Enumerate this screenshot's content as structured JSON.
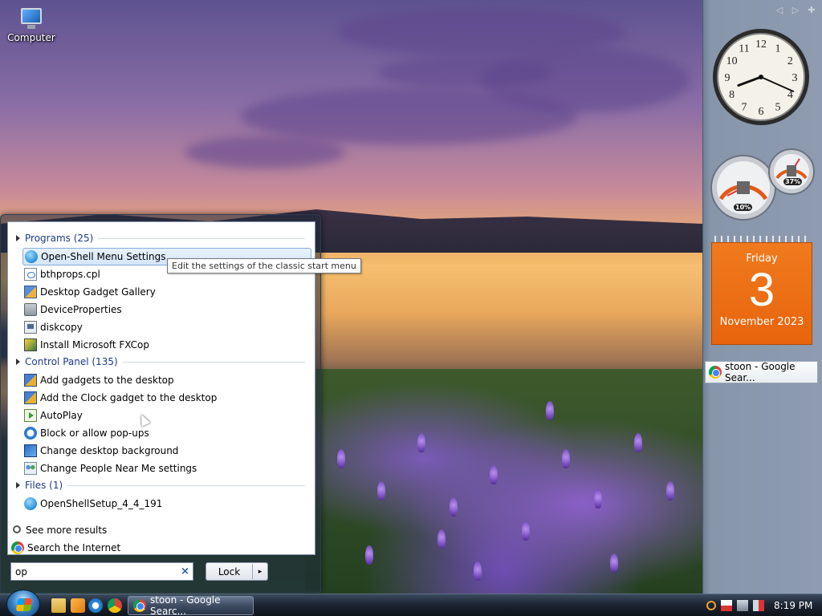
{
  "desktop": {
    "icons": [
      {
        "label": "Computer",
        "icon": "computer-icon"
      }
    ]
  },
  "sidebar": {
    "clock": {
      "hour": 8,
      "minute": 19,
      "numerals": [
        "12",
        "1",
        "2",
        "3",
        "4",
        "5",
        "6",
        "7",
        "8",
        "9",
        "10",
        "11"
      ]
    },
    "cpu_meter": {
      "cpu_percent": "10%",
      "memory_percent": "37%"
    },
    "calendar": {
      "weekday": "Friday",
      "day": "3",
      "month_year": "November 2023"
    },
    "chip": {
      "label": "stoon - Google Sear...",
      "icon": "chrome-icon"
    }
  },
  "start_menu": {
    "sections": [
      {
        "header": "Programs (25)",
        "items": [
          {
            "label": "Open-Shell Menu Settings",
            "icon": "globe-icon",
            "selected": true
          },
          {
            "label": "bthprops.cpl",
            "icon": "doc-icon"
          },
          {
            "label": "Desktop Gadget Gallery",
            "icon": "gallery-icon"
          },
          {
            "label": "DeviceProperties",
            "icon": "device-icon"
          },
          {
            "label": "diskcopy",
            "icon": "disk-icon"
          },
          {
            "label": "Install Microsoft FXCop",
            "icon": "install-icon"
          }
        ]
      },
      {
        "header": "Control Panel (135)",
        "items": [
          {
            "label": "Add gadgets to the desktop",
            "icon": "gadget-icon"
          },
          {
            "label": "Add the Clock gadget to the desktop",
            "icon": "gadget-icon"
          },
          {
            "label": "AutoPlay",
            "icon": "autoplay-icon"
          },
          {
            "label": "Block or allow pop-ups",
            "icon": "block-icon"
          },
          {
            "label": "Change desktop background",
            "icon": "desktop-icon"
          },
          {
            "label": "Change People Near Me settings",
            "icon": "people-icon"
          }
        ]
      },
      {
        "header": "Files (1)",
        "items": [
          {
            "label": "OpenShellSetup_4_4_191",
            "icon": "globe-icon"
          }
        ]
      }
    ],
    "see_more": "See more results",
    "search_internet": "Search the Internet",
    "tooltip": "Edit the settings of the classic start menu",
    "search": {
      "value": "op",
      "clear": "×"
    },
    "lock_button": {
      "label": "Lock",
      "arrow": "▸"
    }
  },
  "taskbar": {
    "task_button": {
      "label": "stoon - Google Searc...",
      "icon": "chrome-icon"
    },
    "clock": "8:19 PM"
  }
}
